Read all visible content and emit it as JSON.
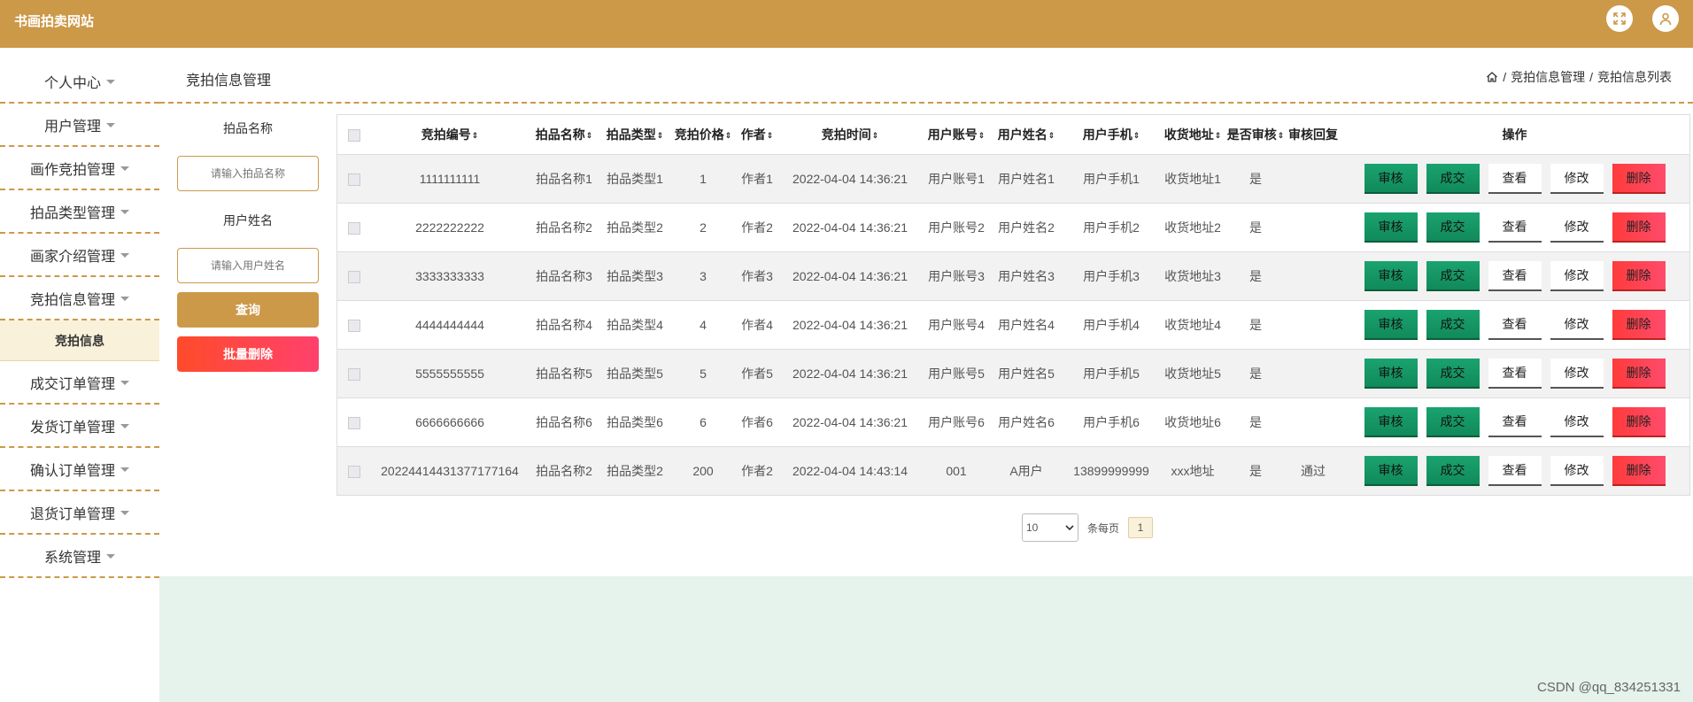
{
  "app": {
    "title": "书画拍卖网站"
  },
  "sidebar": {
    "items": [
      {
        "label": "个人中心"
      },
      {
        "label": "用户管理"
      },
      {
        "label": "画作竞拍管理"
      },
      {
        "label": "拍品类型管理"
      },
      {
        "label": "画家介绍管理"
      },
      {
        "label": "竞拍信息管理"
      },
      {
        "label": "竞拍信息"
      },
      {
        "label": "成交订单管理"
      },
      {
        "label": "发货订单管理"
      },
      {
        "label": "确认订单管理"
      },
      {
        "label": "退货订单管理"
      },
      {
        "label": "系统管理"
      }
    ]
  },
  "page": {
    "title": "竞拍信息管理"
  },
  "breadcrumb": {
    "item1": "竞拍信息管理",
    "item2": "竞拍信息列表",
    "separator": "/"
  },
  "search": {
    "field1_label": "拍品名称",
    "field1_placeholder": "请输入拍品名称",
    "field2_label": "用户姓名",
    "field2_placeholder": "请输入用户姓名",
    "query_label": "查询",
    "batch_delete_label": "批量删除"
  },
  "table": {
    "headers": [
      "竞拍编号",
      "拍品名称",
      "拍品类型",
      "竞拍价格",
      "作者",
      "竞拍时间",
      "用户账号",
      "用户姓名",
      "用户手机",
      "收货地址",
      "是否审核",
      "审核回复",
      "操作"
    ],
    "ops": {
      "audit": "审核",
      "deal": "成交",
      "view": "查看",
      "edit": "修改",
      "delete": "删除"
    },
    "rows": [
      [
        "1111111111",
        "拍品名称1",
        "拍品类型1",
        "1",
        "作者1",
        "2022-04-04 14:36:21",
        "用户账号1",
        "用户姓名1",
        "用户手机1",
        "收货地址1",
        "是",
        ""
      ],
      [
        "2222222222",
        "拍品名称2",
        "拍品类型2",
        "2",
        "作者2",
        "2022-04-04 14:36:21",
        "用户账号2",
        "用户姓名2",
        "用户手机2",
        "收货地址2",
        "是",
        ""
      ],
      [
        "3333333333",
        "拍品名称3",
        "拍品类型3",
        "3",
        "作者3",
        "2022-04-04 14:36:21",
        "用户账号3",
        "用户姓名3",
        "用户手机3",
        "收货地址3",
        "是",
        ""
      ],
      [
        "4444444444",
        "拍品名称4",
        "拍品类型4",
        "4",
        "作者4",
        "2022-04-04 14:36:21",
        "用户账号4",
        "用户姓名4",
        "用户手机4",
        "收货地址4",
        "是",
        ""
      ],
      [
        "5555555555",
        "拍品名称5",
        "拍品类型5",
        "5",
        "作者5",
        "2022-04-04 14:36:21",
        "用户账号5",
        "用户姓名5",
        "用户手机5",
        "收货地址5",
        "是",
        ""
      ],
      [
        "6666666666",
        "拍品名称6",
        "拍品类型6",
        "6",
        "作者6",
        "2022-04-04 14:36:21",
        "用户账号6",
        "用户姓名6",
        "用户手机6",
        "收货地址6",
        "是",
        ""
      ],
      [
        "20224414431377177164",
        "拍品名称2",
        "拍品类型2",
        "200",
        "作者2",
        "2022-04-04 14:43:14",
        "001",
        "A用户",
        "13899999999",
        "xxx地址",
        "是",
        "通过"
      ]
    ]
  },
  "pager": {
    "page_size": "10",
    "per_page_label": "条每页",
    "current_page": "1"
  },
  "watermark": "CSDN @qq_834251331",
  "colors": {
    "primary": "#cc9949",
    "audit_green": "#1aa36f",
    "delete_red": "#ff4b4b"
  }
}
